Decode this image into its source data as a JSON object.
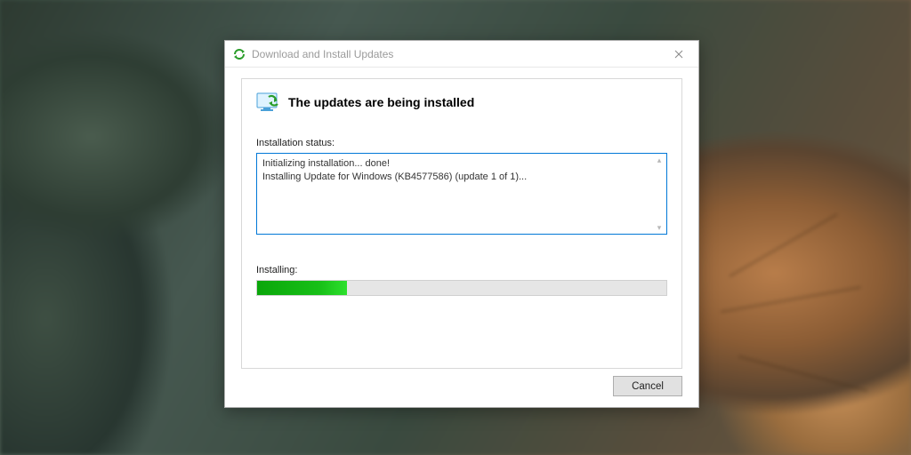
{
  "window": {
    "title": "Download and Install Updates",
    "icon": "update-arrows-icon"
  },
  "header": {
    "icon": "update-screen-icon",
    "heading": "The updates are being installed"
  },
  "status": {
    "label": "Installation status:",
    "lines": [
      "Initializing installation... done!",
      "Installing Update for Windows (KB4577586) (update 1 of 1)..."
    ]
  },
  "progress": {
    "label": "Installing:",
    "percent": 22
  },
  "buttons": {
    "cancel": "Cancel"
  }
}
